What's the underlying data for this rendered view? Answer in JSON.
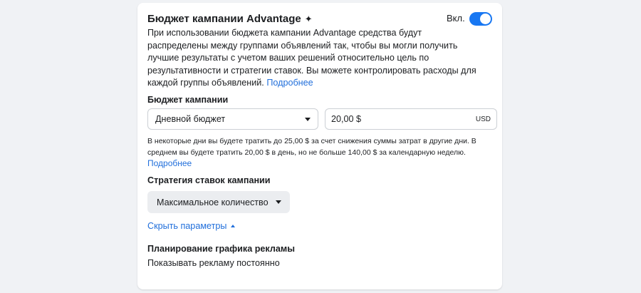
{
  "header": {
    "title": "Бюджет кампании Advantage",
    "sparkle": "✦",
    "toggle_label": "Вкл.",
    "toggle_on": true
  },
  "description": {
    "text": "При использовании бюджета кампании Advantage средства будут распределены между группами объявлений так, чтобы вы могли получить лучшие результаты с учетом ваших решений относительно цель по результативности и стратегии ставок. Вы можете контролировать расходы для каждой группы объявлений.",
    "link": "Подробнее"
  },
  "budget": {
    "label": "Бюджет кампании",
    "type_selected": "Дневной бюджет",
    "amount": "20,00 $",
    "currency": "USD",
    "hint": "В некоторые дни вы будете тратить до 25,00 $ за счет снижения суммы затрат в другие дни. В среднем вы будете тратить 20,00 $ в день, но не больше 140,00 $ за календарную неделю.",
    "hint_link": "Подробнее"
  },
  "bid_strategy": {
    "label": "Стратегия ставок кампании",
    "selected": "Максимальное количество"
  },
  "hide_params_label": "Скрыть параметры",
  "schedule": {
    "label": "Планирование графика рекламы",
    "value": "Показывать рекламу постоянно"
  },
  "colors": {
    "accent": "#1877f2",
    "link": "#216fdb",
    "background": "#f0f2f5"
  }
}
